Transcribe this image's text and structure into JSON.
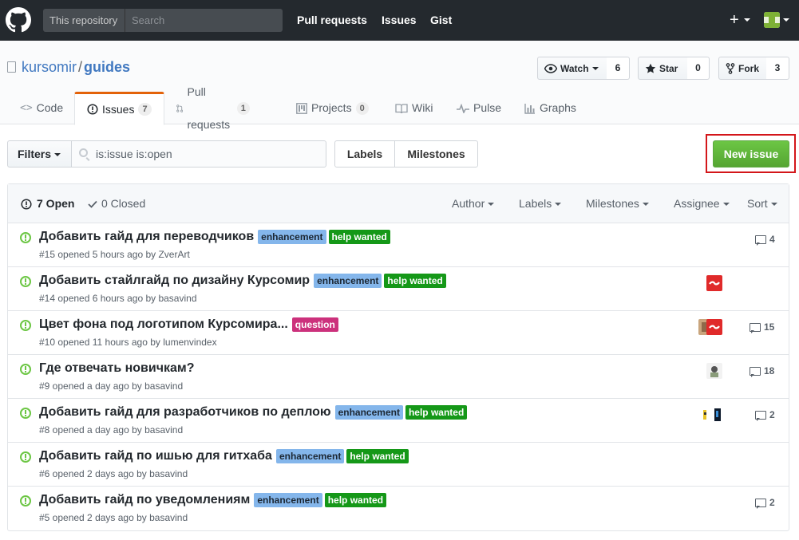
{
  "header": {
    "search_scope": "This repository",
    "search_placeholder": "Search",
    "nav": [
      "Pull requests",
      "Issues",
      "Gist"
    ],
    "plus": "+"
  },
  "repo": {
    "owner": "kursomir",
    "separator": "/",
    "name": "guides",
    "watch_label": "Watch",
    "watch_count": "6",
    "star_label": "Star",
    "star_count": "0",
    "fork_label": "Fork",
    "fork_count": "3"
  },
  "tabs": {
    "code": "Code",
    "issues": "Issues",
    "issues_count": "7",
    "pulls": "Pull requests",
    "pulls_count": "1",
    "projects": "Projects",
    "projects_count": "0",
    "wiki": "Wiki",
    "pulse": "Pulse",
    "graphs": "Graphs"
  },
  "filters": {
    "filters_label": "Filters",
    "query": "is:issue is:open",
    "labels_label": "Labels",
    "milestones_label": "Milestones",
    "new_issue_label": "New issue"
  },
  "issues_header": {
    "open_label": "7 Open",
    "closed_label": "0 Closed",
    "author": "Author",
    "labels": "Labels",
    "milestones": "Milestones",
    "assignee": "Assignee",
    "sort": "Sort"
  },
  "label_colors": {
    "enhancement": {
      "bg": "#84b6eb",
      "fg": "#1c2733"
    },
    "help wanted": {
      "bg": "#159818",
      "fg": "#ffffff"
    },
    "question": {
      "bg": "#cc317c",
      "fg": "#ffffff"
    }
  },
  "issues": [
    {
      "title": "Добавить гайд для переводчиков",
      "labels": [
        "enhancement",
        "help wanted"
      ],
      "meta": "#15 opened 5 hours ago by ZverArt",
      "comments": "4"
    },
    {
      "title": "Добавить стайлгайд по дизайну Курсомир",
      "labels": [
        "enhancement",
        "help wanted"
      ],
      "meta": "#14 opened 6 hours ago by basavind",
      "comments": ""
    },
    {
      "title": "Цвет фона под логотипом Курсомира...",
      "labels": [
        "question"
      ],
      "meta": "#10 opened 11 hours ago by lumenvindex",
      "comments": "15"
    },
    {
      "title": "Где отвечать новичкам?",
      "labels": [],
      "meta": "#9 opened a day ago by basavind",
      "comments": "18"
    },
    {
      "title": "Добавить гайд для разработчиков по деплою",
      "labels": [
        "enhancement",
        "help wanted"
      ],
      "meta": "#8 opened a day ago by basavind",
      "comments": "2"
    },
    {
      "title": "Добавить гайд по ишью для гитхаба",
      "labels": [
        "enhancement",
        "help wanted"
      ],
      "meta": "#6 opened 2 days ago by basavind",
      "comments": ""
    },
    {
      "title": "Добавить гайд по уведомлениям",
      "labels": [
        "enhancement",
        "help wanted"
      ],
      "meta": "#5 opened 2 days ago by basavind",
      "comments": "2"
    }
  ]
}
